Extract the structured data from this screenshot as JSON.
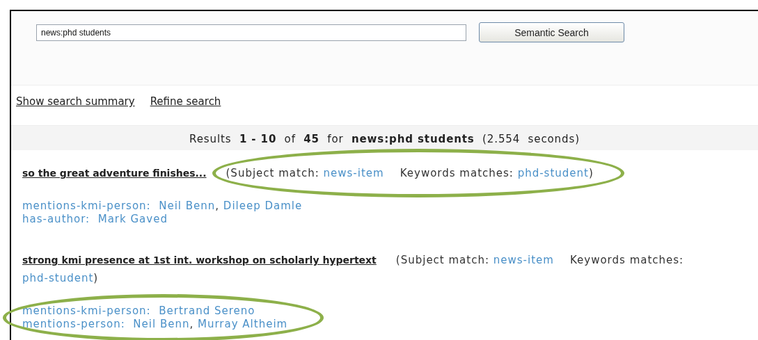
{
  "search": {
    "value": "news:phd students",
    "button": "Semantic Search"
  },
  "links": [
    "Show search summary",
    "Refine search"
  ],
  "summary": "Results  **1 - 10**  of  **45**  for  **news:phd students**  (2.554  seconds)",
  "results": [
    {
      "title": "so the great adventure finishes...",
      "subject_label": "(Subject match:",
      "subject": "news-item",
      "keywords_label": "Keywords matches:",
      "keyword": "phd-student",
      "close": ")",
      "match_highlighted": true,
      "properties_highlighted": false,
      "separator": ",",
      "properties": [
        {
          "label": "mentions-kmi-person:",
          "values": [
            "Neil Benn",
            "Dileep Damle"
          ]
        },
        {
          "label": "has-author:",
          "values": [
            "Mark Gaved"
          ]
        }
      ]
    },
    {
      "title": "strong kmi presence at 1st int. workshop on scholarly hypertext",
      "subject_label": "(Subject match:",
      "subject": "news-item",
      "keywords_label": "Keywords matches:",
      "keyword": "phd-student",
      "close": ")",
      "match_highlighted": false,
      "properties_highlighted": true,
      "separator": ",",
      "properties": [
        {
          "label": "mentions-kmi-person:",
          "values": [
            "Bertrand Sereno"
          ]
        },
        {
          "label": "mentions-person:",
          "values": [
            "Neil Benn",
            "Murray Altheim"
          ]
        }
      ]
    }
  ]
}
